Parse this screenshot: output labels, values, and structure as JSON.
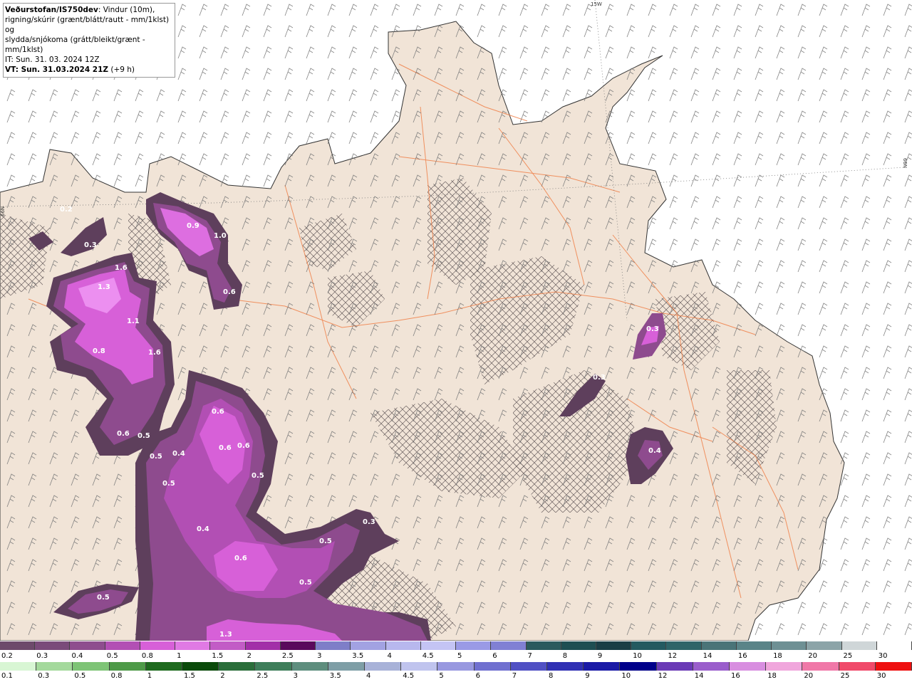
{
  "legend": {
    "source": "Veðurstofan/IS750dev",
    "line1": ": Vindur (10m),",
    "line2": "rigning/skúrir (grænt/blátt/rautt - mm/1klst) og",
    "line3": "slydda/snjókoma (grátt/bleikt/grænt - mm/1klst)",
    "issue": "IT: Sun. 31. 03. 2024 12Z",
    "valid_label": "VT: Sun. 31.03.2024 21Z",
    "valid_offset": " (+9 h)"
  },
  "grid_labels": {
    "lon": "15W",
    "lat_right": "66N",
    "lat_left": "66N"
  },
  "precip_labels": [
    "0.2",
    "0.3",
    "0.9",
    "1.0",
    "0.6",
    "1.6",
    "1.3",
    "1.1",
    "0.8",
    "1.6",
    "0.6",
    "0.5",
    "0.5",
    "0.4",
    "0.5",
    "0.6",
    "0.6",
    "0.6",
    "0.5",
    "0.4",
    "0.3",
    "0.5",
    "0.6",
    "0.5",
    "0.5",
    "1.3",
    "0.3",
    "0.3",
    "0.4"
  ],
  "snow_scale": {
    "labels": [
      "0.2",
      "0.3",
      "0.4",
      "0.5",
      "0.8",
      "1",
      "1.5",
      "2",
      "2.5",
      "3",
      "3.5",
      "4",
      "4.5",
      "5",
      "6",
      "7",
      "8",
      "9",
      "10",
      "12",
      "14",
      "16",
      "18",
      "20",
      "25",
      "30"
    ],
    "colors": [
      "#6d4a6b",
      "#7a4b7a",
      "#8e4d8e",
      "#b24fb4",
      "#d760d8",
      "#e07ae4",
      "#c25cc6",
      "#a22fa8",
      "#5a0a5c",
      "#7e7ec8",
      "#a2a2e2",
      "#b8b8ee",
      "#c4c4f4",
      "#9a9ae6",
      "#8080d4",
      "#2a5a5e",
      "#1e4e52",
      "#1a3e46",
      "#245a60",
      "#2e6468",
      "#4a7478",
      "#5a8488",
      "#6e9094",
      "#8ca4a8",
      "#cfd6d8",
      "#ffffff"
    ]
  },
  "rain_scale": {
    "labels": [
      "0.1",
      "0.3",
      "0.5",
      "0.8",
      "1",
      "1.5",
      "2",
      "2.5",
      "3",
      "3.5",
      "4",
      "4.5",
      "5",
      "6",
      "7",
      "8",
      "9",
      "10",
      "12",
      "14",
      "16",
      "18",
      "20",
      "25",
      "30"
    ],
    "colors": [
      "#d8f6d4",
      "#a4d99c",
      "#7ec476",
      "#4e9a48",
      "#1e6a1e",
      "#0a4a0a",
      "#2a6e3a",
      "#3e7e5a",
      "#5e8e7e",
      "#7e9ea6",
      "#a8b2d8",
      "#c0c4ee",
      "#9898e0",
      "#7070d0",
      "#5050c4",
      "#3030b4",
      "#1a1aa6",
      "#00008a",
      "#6a3ab6",
      "#9a5ecc",
      "#d88ee0",
      "#f0a6dc",
      "#f078a8",
      "#f04a6a",
      "#ee1010"
    ]
  }
}
